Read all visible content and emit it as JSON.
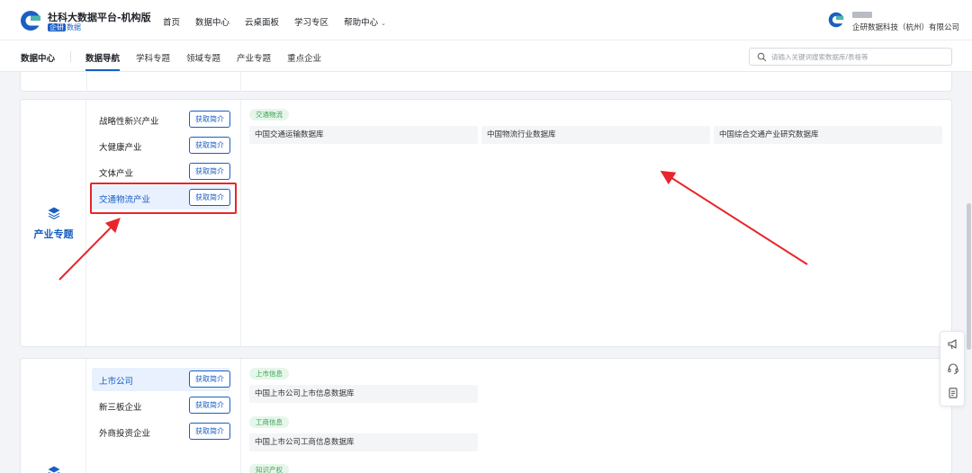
{
  "header": {
    "title": "社科大数据平台-机构版",
    "sub_badge": "企研",
    "sub_text": "数据",
    "nav": [
      "首页",
      "数据中心",
      "云桌面板",
      "学习专区",
      "帮助中心"
    ],
    "user_company": "企研数据科技（杭州）有限公司"
  },
  "subnav": {
    "home": "数据中心",
    "tabs": [
      "数据导航",
      "学科专题",
      "领域专题",
      "产业专题",
      "重点企业"
    ],
    "active_tab": "数据导航",
    "search_placeholder": "请输入关键词搜索数据库/表格等"
  },
  "section1": {
    "category_label": "产业专题",
    "industries": [
      {
        "name": "战略性新兴产业",
        "button": "获取简介"
      },
      {
        "name": "大健康产业",
        "button": "获取简介"
      },
      {
        "name": "文体产业",
        "button": "获取简介"
      },
      {
        "name": "交通物流产业",
        "button": "获取简介"
      }
    ],
    "selected_industry": "交通物流产业",
    "group_tag": "交通物流",
    "databases": [
      "中国交通运输数据库",
      "中国物流行业数据库",
      "中国综合交通产业研究数据库"
    ]
  },
  "section2": {
    "companies": [
      {
        "name": "上市公司",
        "button": "获取简介"
      },
      {
        "name": "新三板企业",
        "button": "获取简介"
      },
      {
        "name": "外商投资企业",
        "button": "获取简介"
      }
    ],
    "selected_company": "上市公司",
    "groups": [
      {
        "tag": "上市信息",
        "db": "中国上市公司上市信息数据库"
      },
      {
        "tag": "工商信息",
        "db": "中国上市公司工商信息数据库"
      },
      {
        "tag": "知识产权"
      }
    ]
  },
  "colors": {
    "accent": "#1a5fc4",
    "tag_green": "#3aa454",
    "annotation_red": "#e8252a"
  }
}
